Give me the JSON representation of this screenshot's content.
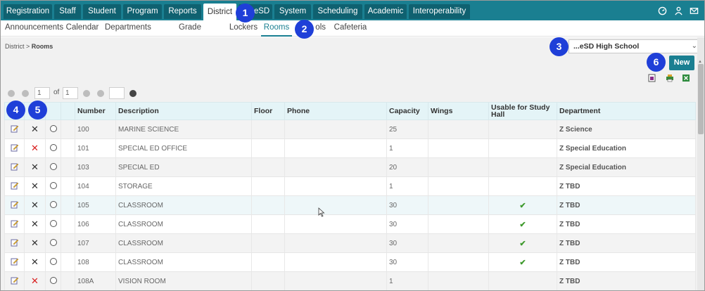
{
  "top_tabs": [
    {
      "label": "Registration",
      "active": false
    },
    {
      "label": "Staff",
      "active": false
    },
    {
      "label": "Student",
      "active": false
    },
    {
      "label": "Program",
      "active": false
    },
    {
      "label": "Reports",
      "active": false
    },
    {
      "label": "District",
      "active": true
    },
    {
      "label": "eSD",
      "active": false
    },
    {
      "label": "System",
      "active": false
    },
    {
      "label": "Scheduling",
      "active": false
    },
    {
      "label": "Academic",
      "active": false
    },
    {
      "label": "Interoperability",
      "active": false
    }
  ],
  "top_icons": [
    "speedometer-icon",
    "user-icon",
    "mail-icon"
  ],
  "sub_tabs": [
    {
      "label": "Announcements",
      "active": false
    },
    {
      "label": "Calendar",
      "active": false
    },
    {
      "label": "Departments",
      "active": false
    },
    {
      "label": "Grade Advancement",
      "active": false
    },
    {
      "label": "Lockers",
      "active": false
    },
    {
      "label": "Rooms",
      "active": true
    },
    {
      "label": "ols",
      "active": false
    },
    {
      "label": "Cafeteria",
      "active": false
    }
  ],
  "breadcrumb": {
    "root": "District",
    "sep": ">",
    "current": "Rooms"
  },
  "school_select": {
    "value": "...eSD High School"
  },
  "new_button": "New",
  "pager": {
    "page": "1",
    "of": "of",
    "total": "1",
    "size": ""
  },
  "columns": [
    "Number",
    "Description",
    "Floor",
    "Phone",
    "Capacity",
    "Wings",
    "Usable for Study Hall",
    "Department"
  ],
  "rows": [
    {
      "number": "100",
      "description": "MARINE SCIENCE",
      "floor": "",
      "phone": "",
      "capacity": "25",
      "wings": "",
      "study_hall": false,
      "department": "Z Science",
      "delete_red": false
    },
    {
      "number": "101",
      "description": "SPECIAL ED OFFICE",
      "floor": "",
      "phone": "",
      "capacity": "1",
      "wings": "",
      "study_hall": false,
      "department": "Z Special Education",
      "delete_red": true
    },
    {
      "number": "103",
      "description": "SPECIAL ED",
      "floor": "",
      "phone": "",
      "capacity": "20",
      "wings": "",
      "study_hall": false,
      "department": "Z Special Education",
      "delete_red": false
    },
    {
      "number": "104",
      "description": "STORAGE",
      "floor": "",
      "phone": "",
      "capacity": "1",
      "wings": "",
      "study_hall": false,
      "department": "Z TBD",
      "delete_red": false
    },
    {
      "number": "105",
      "description": "CLASSROOM",
      "floor": "",
      "phone": "",
      "capacity": "30",
      "wings": "",
      "study_hall": true,
      "department": "Z TBD",
      "delete_red": false
    },
    {
      "number": "106",
      "description": "CLASSROOM",
      "floor": "",
      "phone": "",
      "capacity": "30",
      "wings": "",
      "study_hall": true,
      "department": "Z TBD",
      "delete_red": false
    },
    {
      "number": "107",
      "description": "CLASSROOM",
      "floor": "",
      "phone": "",
      "capacity": "30",
      "wings": "",
      "study_hall": true,
      "department": "Z TBD",
      "delete_red": false
    },
    {
      "number": "108",
      "description": "CLASSROOM",
      "floor": "",
      "phone": "",
      "capacity": "30",
      "wings": "",
      "study_hall": true,
      "department": "Z TBD",
      "delete_red": false
    },
    {
      "number": "108A",
      "description": "VISION ROOM",
      "floor": "",
      "phone": "",
      "capacity": "1",
      "wings": "",
      "study_hall": false,
      "department": "Z TBD",
      "delete_red": true
    }
  ],
  "callouts": [
    "1",
    "2",
    "3",
    "4",
    "5",
    "6"
  ],
  "colors": {
    "nav": "#1a7f91",
    "nav_tab": "#0f6170",
    "callout": "#1f3fd8",
    "header": "#e4f4f7",
    "delete_red": "#d92020",
    "check": "#3f9a2e"
  }
}
